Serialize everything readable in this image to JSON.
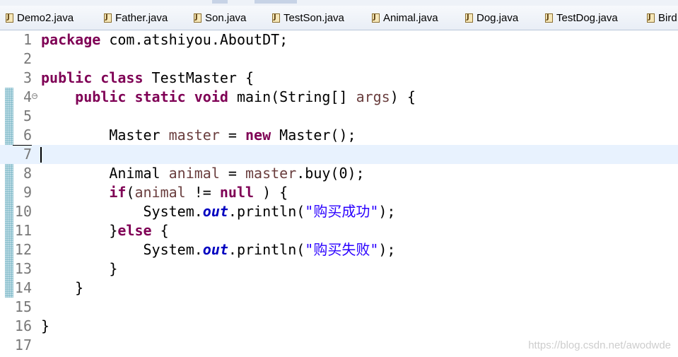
{
  "tabs": [
    {
      "label": "Demo2.java"
    },
    {
      "label": "Father.java"
    },
    {
      "label": "Son.java"
    },
    {
      "label": "TestSon.java"
    },
    {
      "label": "Animal.java"
    },
    {
      "label": "Dog.java"
    },
    {
      "label": "TestDog.java"
    },
    {
      "label": "Bird"
    }
  ],
  "editor": {
    "line_numbers": [
      "1",
      "2",
      "3",
      "4",
      "5",
      "6",
      "7",
      "8",
      "9",
      "10",
      "11",
      "12",
      "13",
      "14",
      "15",
      "16",
      "17"
    ],
    "current_line": "7",
    "code": {
      "package_kw": "package",
      "package_name": " com.atshiyou.AboutDT;",
      "public_kw": "public",
      "class_kw": "class",
      "class_name": " TestMaster {",
      "static_kw": "static",
      "void_kw": "void",
      "main_sig": " main(String[] ",
      "args_var": "args",
      "main_end": ") {",
      "master_type": "Master ",
      "master_var": "master",
      "assign": " = ",
      "new_kw": "new",
      "master_ctor": " Master();",
      "animal_type": "Animal ",
      "animal_var": "animal",
      "buy_call": ".buy(0);",
      "if_kw": "if",
      "open_paren": "(",
      "neq": " != ",
      "null_kw": "null",
      "if_end": " ) {",
      "system": "System.",
      "out_field": "out",
      "println_open": ".println(",
      "str_success": "\"购买成功\"",
      "str_fail": "\"购买失败\"",
      "close_stmt": ");",
      "close_brace_open": "}",
      "else_kw": "else",
      "else_tail": " {",
      "close_brace": "}"
    }
  },
  "watermark": "https://blog.csdn.net/awodwde"
}
